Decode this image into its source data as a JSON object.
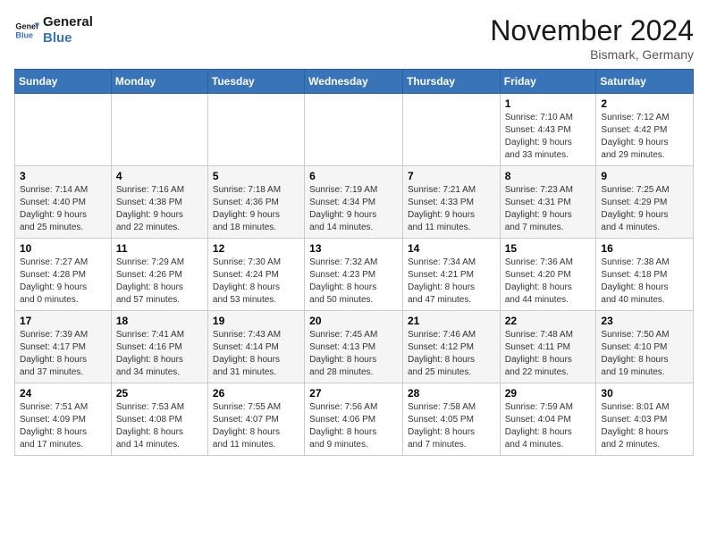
{
  "header": {
    "logo_line1": "General",
    "logo_line2": "Blue",
    "month_title": "November 2024",
    "location": "Bismark, Germany"
  },
  "weekdays": [
    "Sunday",
    "Monday",
    "Tuesday",
    "Wednesday",
    "Thursday",
    "Friday",
    "Saturday"
  ],
  "weeks": [
    [
      {
        "day": "",
        "info": ""
      },
      {
        "day": "",
        "info": ""
      },
      {
        "day": "",
        "info": ""
      },
      {
        "day": "",
        "info": ""
      },
      {
        "day": "",
        "info": ""
      },
      {
        "day": "1",
        "info": "Sunrise: 7:10 AM\nSunset: 4:43 PM\nDaylight: 9 hours\nand 33 minutes."
      },
      {
        "day": "2",
        "info": "Sunrise: 7:12 AM\nSunset: 4:42 PM\nDaylight: 9 hours\nand 29 minutes."
      }
    ],
    [
      {
        "day": "3",
        "info": "Sunrise: 7:14 AM\nSunset: 4:40 PM\nDaylight: 9 hours\nand 25 minutes."
      },
      {
        "day": "4",
        "info": "Sunrise: 7:16 AM\nSunset: 4:38 PM\nDaylight: 9 hours\nand 22 minutes."
      },
      {
        "day": "5",
        "info": "Sunrise: 7:18 AM\nSunset: 4:36 PM\nDaylight: 9 hours\nand 18 minutes."
      },
      {
        "day": "6",
        "info": "Sunrise: 7:19 AM\nSunset: 4:34 PM\nDaylight: 9 hours\nand 14 minutes."
      },
      {
        "day": "7",
        "info": "Sunrise: 7:21 AM\nSunset: 4:33 PM\nDaylight: 9 hours\nand 11 minutes."
      },
      {
        "day": "8",
        "info": "Sunrise: 7:23 AM\nSunset: 4:31 PM\nDaylight: 9 hours\nand 7 minutes."
      },
      {
        "day": "9",
        "info": "Sunrise: 7:25 AM\nSunset: 4:29 PM\nDaylight: 9 hours\nand 4 minutes."
      }
    ],
    [
      {
        "day": "10",
        "info": "Sunrise: 7:27 AM\nSunset: 4:28 PM\nDaylight: 9 hours\nand 0 minutes."
      },
      {
        "day": "11",
        "info": "Sunrise: 7:29 AM\nSunset: 4:26 PM\nDaylight: 8 hours\nand 57 minutes."
      },
      {
        "day": "12",
        "info": "Sunrise: 7:30 AM\nSunset: 4:24 PM\nDaylight: 8 hours\nand 53 minutes."
      },
      {
        "day": "13",
        "info": "Sunrise: 7:32 AM\nSunset: 4:23 PM\nDaylight: 8 hours\nand 50 minutes."
      },
      {
        "day": "14",
        "info": "Sunrise: 7:34 AM\nSunset: 4:21 PM\nDaylight: 8 hours\nand 47 minutes."
      },
      {
        "day": "15",
        "info": "Sunrise: 7:36 AM\nSunset: 4:20 PM\nDaylight: 8 hours\nand 44 minutes."
      },
      {
        "day": "16",
        "info": "Sunrise: 7:38 AM\nSunset: 4:18 PM\nDaylight: 8 hours\nand 40 minutes."
      }
    ],
    [
      {
        "day": "17",
        "info": "Sunrise: 7:39 AM\nSunset: 4:17 PM\nDaylight: 8 hours\nand 37 minutes."
      },
      {
        "day": "18",
        "info": "Sunrise: 7:41 AM\nSunset: 4:16 PM\nDaylight: 8 hours\nand 34 minutes."
      },
      {
        "day": "19",
        "info": "Sunrise: 7:43 AM\nSunset: 4:14 PM\nDaylight: 8 hours\nand 31 minutes."
      },
      {
        "day": "20",
        "info": "Sunrise: 7:45 AM\nSunset: 4:13 PM\nDaylight: 8 hours\nand 28 minutes."
      },
      {
        "day": "21",
        "info": "Sunrise: 7:46 AM\nSunset: 4:12 PM\nDaylight: 8 hours\nand 25 minutes."
      },
      {
        "day": "22",
        "info": "Sunrise: 7:48 AM\nSunset: 4:11 PM\nDaylight: 8 hours\nand 22 minutes."
      },
      {
        "day": "23",
        "info": "Sunrise: 7:50 AM\nSunset: 4:10 PM\nDaylight: 8 hours\nand 19 minutes."
      }
    ],
    [
      {
        "day": "24",
        "info": "Sunrise: 7:51 AM\nSunset: 4:09 PM\nDaylight: 8 hours\nand 17 minutes."
      },
      {
        "day": "25",
        "info": "Sunrise: 7:53 AM\nSunset: 4:08 PM\nDaylight: 8 hours\nand 14 minutes."
      },
      {
        "day": "26",
        "info": "Sunrise: 7:55 AM\nSunset: 4:07 PM\nDaylight: 8 hours\nand 11 minutes."
      },
      {
        "day": "27",
        "info": "Sunrise: 7:56 AM\nSunset: 4:06 PM\nDaylight: 8 hours\nand 9 minutes."
      },
      {
        "day": "28",
        "info": "Sunrise: 7:58 AM\nSunset: 4:05 PM\nDaylight: 8 hours\nand 7 minutes."
      },
      {
        "day": "29",
        "info": "Sunrise: 7:59 AM\nSunset: 4:04 PM\nDaylight: 8 hours\nand 4 minutes."
      },
      {
        "day": "30",
        "info": "Sunrise: 8:01 AM\nSunset: 4:03 PM\nDaylight: 8 hours\nand 2 minutes."
      }
    ]
  ]
}
